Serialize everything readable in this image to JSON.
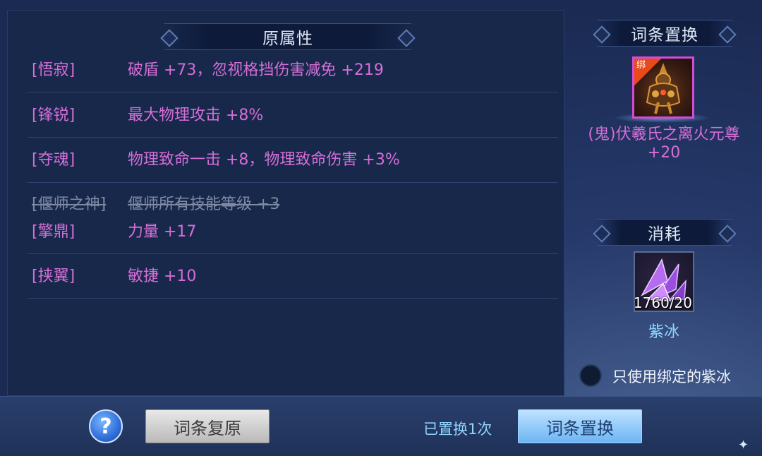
{
  "original_section": {
    "title": "原属性",
    "rows": [
      {
        "tag": "[悟寂]",
        "desc": "破盾 +73，忽视格挡伤害减免 +219",
        "struck": false
      },
      {
        "tag": "[锋锐]",
        "desc": "最大物理攻击 +8%",
        "struck": false
      },
      {
        "tag": "[夺魂]",
        "desc": "物理致命一击 +8，物理致命伤害 +3%",
        "struck": false
      },
      {
        "tag": "[偃师之神]",
        "desc": "偃师所有技能等级 +3",
        "struck": true
      },
      {
        "tag": "[擎鼎]",
        "desc": "力量 +17",
        "struck": false
      },
      {
        "tag": "[挟翼]",
        "desc": "敏捷 +10",
        "struck": false
      }
    ]
  },
  "replace_section": {
    "title": "词条置换",
    "item": {
      "bind_badge": "绑",
      "name": "(鬼)伏羲氏之离火元尊 +20",
      "icon": "armored-figure-icon"
    }
  },
  "cost_section": {
    "title": "消耗",
    "item": {
      "icon": "purple-crystal-icon",
      "count": "1760/20",
      "name": "紫冰"
    },
    "checkbox_label": "只使用绑定的紫冰"
  },
  "footer": {
    "help_glyph": "?",
    "restore_button": "词条复原",
    "replaced_count": "已置换1次",
    "replace_button": "词条置换"
  },
  "colors": {
    "attribute_text": "#d56ed6",
    "struck_text": "#7e8aa4",
    "item_frame": "#d54bd5",
    "cyan_label": "#8fd6ff"
  }
}
